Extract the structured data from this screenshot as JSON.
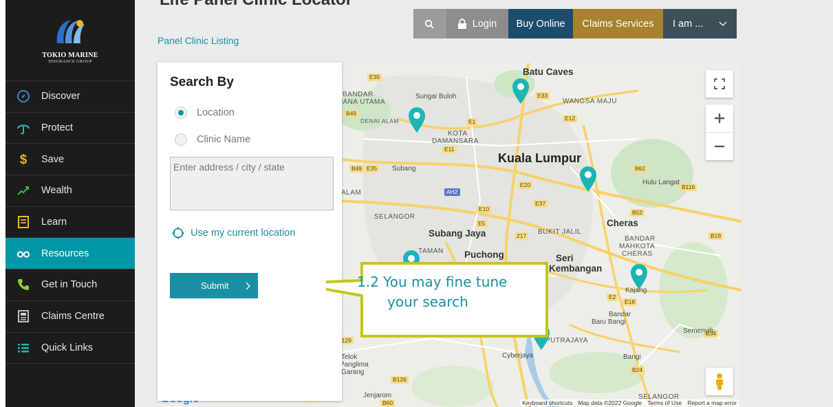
{
  "sidebar": {
    "brand_line1": "TOKIO MARINE",
    "brand_line2": "INSURANCE GROUP",
    "items": [
      {
        "label": "Discover",
        "icon": "compass-icon"
      },
      {
        "label": "Protect",
        "icon": "umbrella-icon"
      },
      {
        "label": "Save",
        "icon": "dollar-icon"
      },
      {
        "label": "Wealth",
        "icon": "growth-chart-icon"
      },
      {
        "label": "Learn",
        "icon": "notebook-icon"
      },
      {
        "label": "Resources",
        "icon": "glasses-icon",
        "active": true
      },
      {
        "label": "Get in Touch",
        "icon": "phone-icon"
      },
      {
        "label": "Claims Centre",
        "icon": "newspaper-icon"
      },
      {
        "label": "Quick Links",
        "icon": "list-icon"
      }
    ]
  },
  "header": {
    "page_title": "Life Panel Clinic Locator",
    "breadcrumb": "Panel Clinic Listing",
    "login": "Login",
    "buy_online": "Buy Online",
    "claims_services": "Claims Services",
    "i_am": "I am ..."
  },
  "search": {
    "title": "Search By",
    "option_location": "Location",
    "option_clinic_name": "Clinic Name",
    "selected": "Location",
    "address_placeholder": "Enter address / city / state",
    "address_value": "",
    "use_location": "Use my current location",
    "submit": "Submit"
  },
  "callout": {
    "line1": "1.2 You may fine tune",
    "line2": "your search"
  },
  "map": {
    "labels": {
      "batu_caves": "Batu Caves",
      "bandar": "BANDAR",
      "jana_utama": "JANA UTAMA",
      "sungai_buloh": "Sungai Buloh",
      "wangsa_maju": "WANGSA MAJU",
      "denai_alam": "DENAI ALAM",
      "kota": "KOTA",
      "damansara": "DAMANSARA",
      "kuala_lumpur": "Kuala Lumpur",
      "subang": "Subang",
      "hulu_langat": "Hulu Langat",
      "alam": "ALAM",
      "selangor": "SELANGOR",
      "cheras": "Cheras",
      "subang_jaya": "Subang Jaya",
      "bukit_jalil": "BUKIT JALIL",
      "bandar_mahkota_cheras_1": "BANDAR",
      "bandar_mahkota_cheras_2": "MAHKOTA",
      "bandar_mahkota_cheras_3": "CHERAS",
      "taman": "TAMAN",
      "puchong": "Puchong",
      "seri_kembangan_1": "Seri",
      "seri_kembangan_2": "Kembangan",
      "kajang": "Kajang",
      "bandar_baru_bangi_1": "Bandar",
      "bandar_baru_bangi_2": "Baru Bangi",
      "semenyih": "Semenyih",
      "putrajaya": "PUTRAJAYA",
      "cyberjaya": "Cyberjaya",
      "bangi": "Bangi",
      "telok_panglima_garang_1": "Telok",
      "telok_panglima_garang_2": "Panglima",
      "telok_panglima_garang_3": "Garang",
      "jenjarom": "Jenjarom",
      "selangor_bottom": "SELANGOR"
    },
    "google": "Google",
    "footer_shortcuts": "Keyboard shortcuts",
    "footer_data": "Map data ©2022 Google",
    "footer_terms": "Terms of Use",
    "footer_report": "Report a map error"
  },
  "colors": {
    "teal": "#0097a7",
    "navy": "#1d4d6c",
    "gold": "#a8822f",
    "callout_border": "#c8c41a"
  }
}
